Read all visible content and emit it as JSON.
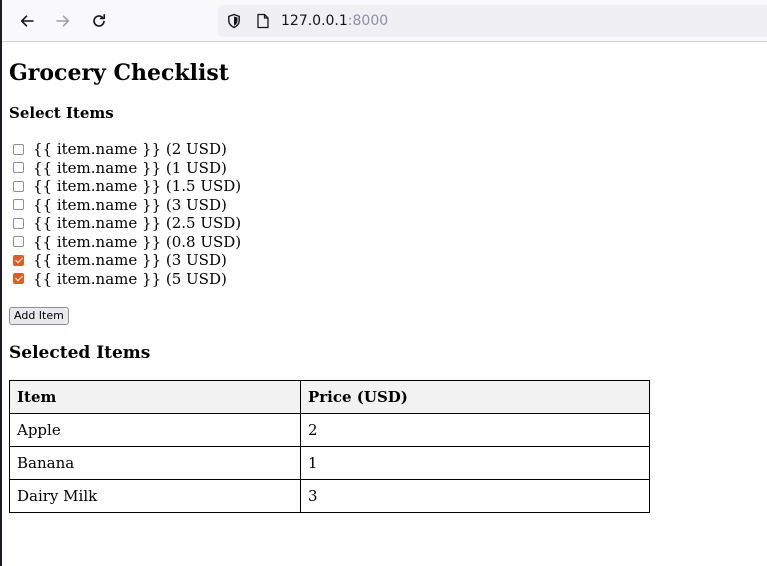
{
  "browser": {
    "url_host": "127.0.0.1",
    "url_port": ":8000"
  },
  "page": {
    "title": "Grocery Checklist",
    "select_heading": "Select Items",
    "items": [
      {
        "label": "{{ item.name }} (2 USD)",
        "checked": false
      },
      {
        "label": "{{ item.name }} (1 USD)",
        "checked": false
      },
      {
        "label": "{{ item.name }} (1.5 USD)",
        "checked": false
      },
      {
        "label": "{{ item.name }} (3 USD)",
        "checked": false
      },
      {
        "label": "{{ item.name }} (2.5 USD)",
        "checked": false
      },
      {
        "label": "{{ item.name }} (0.8 USD)",
        "checked": false
      },
      {
        "label": "{{ item.name }} (3 USD)",
        "checked": true
      },
      {
        "label": "{{ item.name }} (5 USD)",
        "checked": true
      }
    ],
    "add_button": "Add Item",
    "selected_heading": "Selected Items",
    "table": {
      "headers": [
        "Item",
        "Price (USD)"
      ],
      "rows": [
        [
          "Apple",
          "2"
        ],
        [
          "Banana",
          "1"
        ],
        [
          "Dairy Milk",
          "3"
        ]
      ]
    }
  },
  "colors": {
    "checkbox_checked": "#e25d25"
  }
}
